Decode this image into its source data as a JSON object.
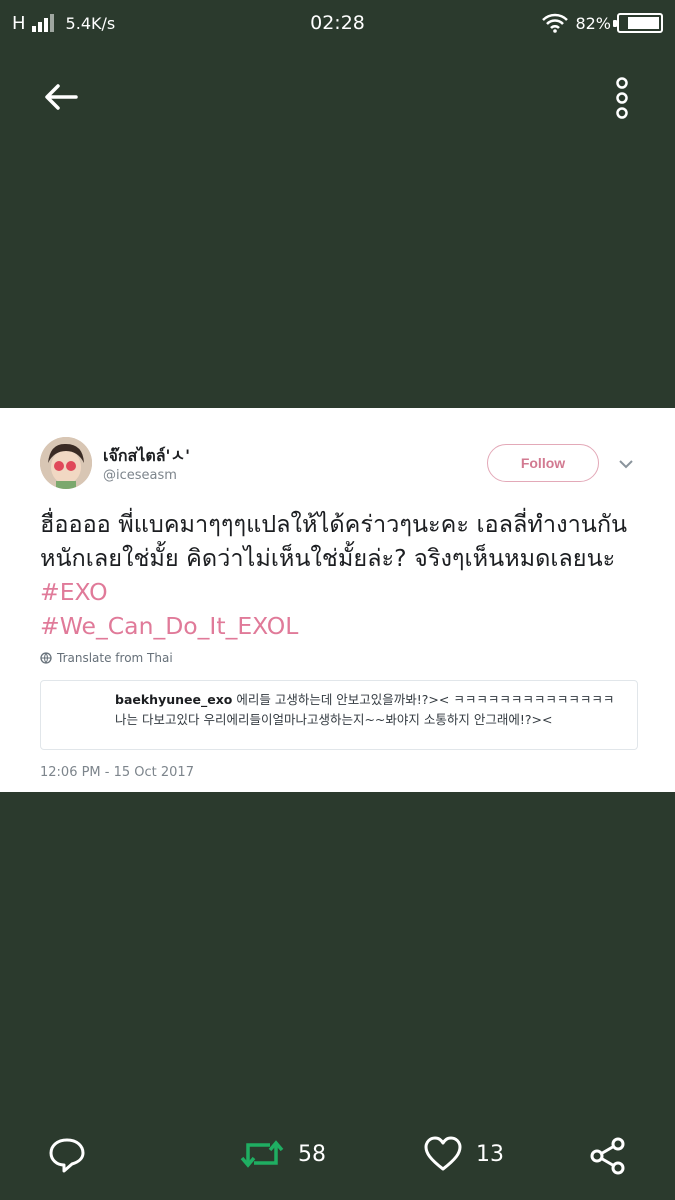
{
  "status_bar": {
    "network": "H",
    "speed": "5.4K/s",
    "time": "02:28",
    "battery": "82%",
    "battery_level": 0.82
  },
  "toolbar": {
    "back_icon": "arrow-left-icon",
    "more_icon": "vertical-dots-icon"
  },
  "tweet": {
    "display_name": "เจ๊กสไตล์'ㅅ'",
    "handle": "@iceseasm",
    "follow_label": "Follow",
    "text_body": "ฮื่ออออ พี่แบคมาๆๆๆแปลให้ได้คร่าวๆนะคะ เอลลี่ทำงานกันหนักเลยใช่มั้ย คิดว่าไม่เห็นใช่มั้ยล่ะ? จริงๆเห็นหมดเลยนะ ",
    "hashtag_1": "#EXO",
    "hashtag_2": "#We_Can_Do_It_EXOL",
    "translate_label": "Translate from Thai",
    "quote": {
      "user": "baekhyunee_exo",
      "text": "에리들 고생하는데 안보고있을까봐!?>< ㅋㅋㅋㅋㅋㅋㅋㅋㅋㅋㅋㅋㅋㅋ나는 다보고있다 우리에리들이얼마나고생하는지~~봐야지 소통하지 안그래에!?><"
    },
    "timestamp": "12:06 PM - 15 Oct 2017"
  },
  "actions": {
    "retweet_count": "58",
    "like_count": "13"
  },
  "colors": {
    "background": "#2b3a2d",
    "hashtag": "#e07a99",
    "retweet": "#1fae62"
  }
}
